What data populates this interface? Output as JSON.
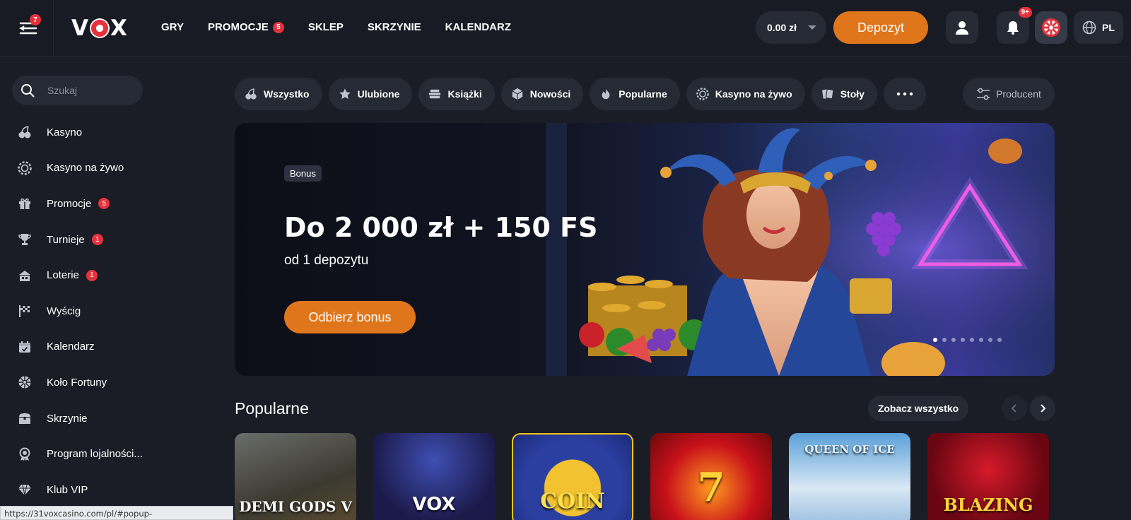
{
  "header": {
    "menu_badge": "7",
    "logo": "VOX",
    "nav": [
      {
        "label": "GRY"
      },
      {
        "label": "PROMOCJE",
        "badge": "5"
      },
      {
        "label": "SKLEP"
      },
      {
        "label": "SKRZYNIE"
      },
      {
        "label": "KALENDARZ"
      }
    ],
    "balance": "0.00 zł",
    "deposit_label": "Depozyt",
    "notifications_badge": "9+",
    "language": "PL"
  },
  "sidebar": {
    "search_placeholder": "Szukaj",
    "items": [
      {
        "label": "Kasyno",
        "icon": "cherries-icon"
      },
      {
        "label": "Kasyno na żywo",
        "icon": "chip-icon"
      },
      {
        "label": "Promocje",
        "icon": "gift-icon",
        "badge": "5"
      },
      {
        "label": "Turnieje",
        "icon": "trophy-icon",
        "badge": "1"
      },
      {
        "label": "Loterie",
        "icon": "lottery-icon",
        "badge": "1"
      },
      {
        "label": "Wyścig",
        "icon": "flag-icon"
      },
      {
        "label": "Kalendarz",
        "icon": "calendar-icon"
      },
      {
        "label": "Koło Fortuny",
        "icon": "wheel-icon"
      },
      {
        "label": "Skrzynie",
        "icon": "chest-icon"
      },
      {
        "label": "Program lojalności...",
        "icon": "award-icon"
      },
      {
        "label": "Klub VIP",
        "icon": "diamond-icon"
      }
    ]
  },
  "filters": [
    {
      "label": "Wszystko",
      "icon": "cherries-icon"
    },
    {
      "label": "Ulubione",
      "icon": "star-icon"
    },
    {
      "label": "Książki",
      "icon": "books-icon"
    },
    {
      "label": "Nowości",
      "icon": "cube-icon"
    },
    {
      "label": "Popularne",
      "icon": "flame-icon"
    },
    {
      "label": "Kasyno na żywo",
      "icon": "chip-icon"
    },
    {
      "label": "Stoły",
      "icon": "cards-icon"
    }
  ],
  "producer_label": "Producent",
  "banner": {
    "tag": "Bonus",
    "headline": "Do 2 000 zł + 150 FS",
    "subline": "od 1 depozytu",
    "cta": "Odbierz bonus",
    "slides_total": 8,
    "active_slide": 1
  },
  "popular": {
    "title": "Popularne",
    "see_all": "Zobacz wszystko",
    "games": [
      {
        "title": "DEMI GODS V"
      },
      {
        "title": "VOX"
      },
      {
        "title": "COIN"
      },
      {
        "title": "7"
      },
      {
        "title": "QUEEN OF ICE"
      },
      {
        "title": "BLAZING"
      }
    ]
  },
  "status_url": "https://31voxcasino.com/pl/#popup-wheelOfForunePaid"
}
